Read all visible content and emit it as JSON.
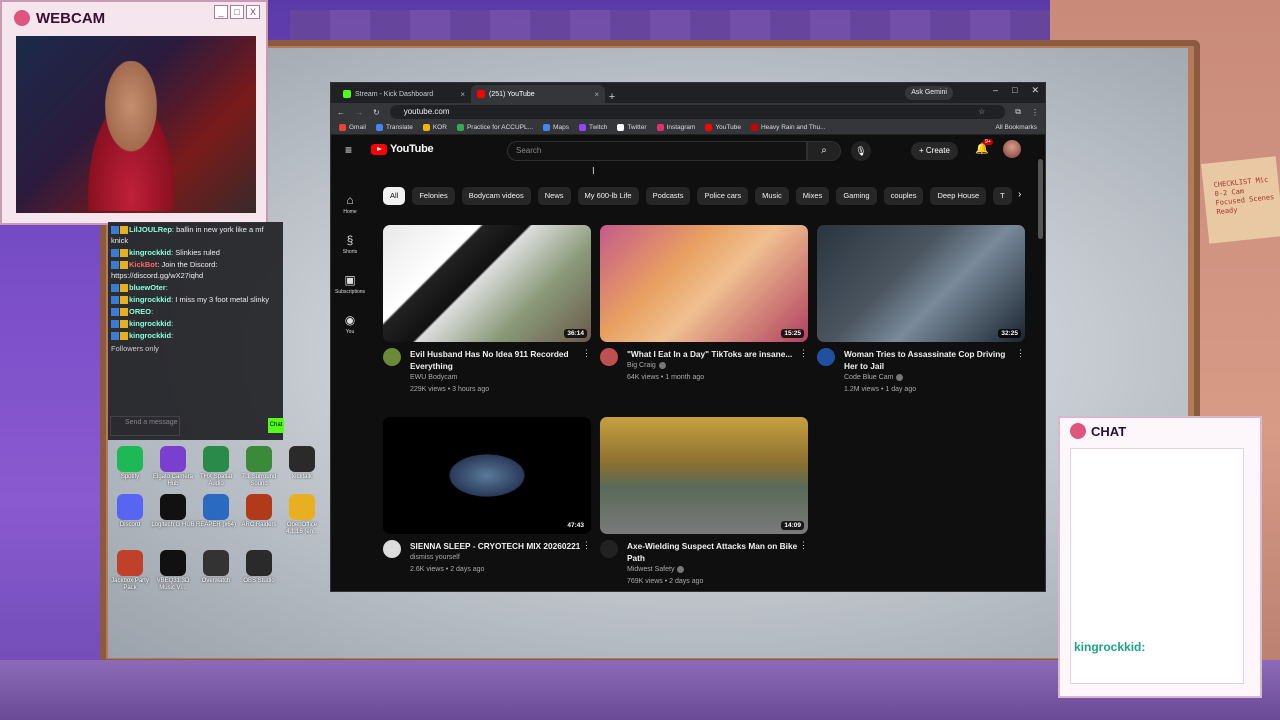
{
  "webcam": {
    "title": "WEBCAM",
    "controls": [
      "_",
      "□",
      "X"
    ]
  },
  "chatlog": {
    "lines": [
      {
        "user": "LilJOULRep",
        "text": "ballin in new york like a mf knick"
      },
      {
        "user": "kingrockkid",
        "text": "Slinkies ruled"
      },
      {
        "user": "KickBot",
        "text": "Join the Discord: https://discord.gg/wX27iqhd"
      },
      {
        "user": "bluewOter",
        "text": ""
      },
      {
        "user": "kingrockkid",
        "text": "I miss my 3 foot metal slinky"
      },
      {
        "user": "OREO",
        "text": ""
      },
      {
        "user": "kingrockkid",
        "text": ""
      },
      {
        "user": "kingrockkid",
        "text": ""
      }
    ],
    "followers_only": "Followers only",
    "input_placeholder": "Send a message",
    "send_label": "Chat"
  },
  "chatpanel": {
    "title": "CHAT",
    "message_user": "kingrockkid:"
  },
  "browser": {
    "tabs": [
      {
        "title": "Stream - Kick Dashboard",
        "color": "#53fc18"
      },
      {
        "title": "(251) YouTube",
        "color": "#ff0000"
      }
    ],
    "gemini": "Ask Gemini",
    "url": "youtube.com",
    "bookmarks": [
      "Gmail",
      "Translate",
      "KOR",
      "Practice for ACCUPL...",
      "Maps",
      "Twitch",
      "Twitter",
      "Instagram",
      "YouTube",
      "Heavy Rain and Thu..."
    ],
    "all_bookmarks": "All Bookmarks"
  },
  "youtube": {
    "logo": "YouTube",
    "search_placeholder": "Search",
    "create": "Create",
    "notif_count": "9+",
    "sidenav": [
      {
        "label": "Home",
        "icon": "home-icon",
        "glyph": "⌂"
      },
      {
        "label": "Shorts",
        "icon": "shorts-icon",
        "glyph": "§"
      },
      {
        "label": "Subscriptions",
        "icon": "subscriptions-icon",
        "glyph": "▣"
      },
      {
        "label": "You",
        "icon": "you-icon",
        "glyph": "◉"
      }
    ],
    "chips": [
      "All",
      "Felonies",
      "Bodycam videos",
      "News",
      "My 600-lb Life",
      "Podcasts",
      "Police cars",
      "Music",
      "Mixes",
      "Gaming",
      "couples",
      "Deep House",
      "T"
    ],
    "videos": [
      {
        "title": "Evil Husband Has No Idea 911 Recorded Everything",
        "channel": "EWU Bodycam",
        "stats": "229K views • 3 hours ago",
        "duration": "36:14",
        "verified": false
      },
      {
        "title": "\"What I Eat In a Day\" TikToks are insane...",
        "channel": "Big Craig",
        "stats": "64K views • 1 month ago",
        "duration": "15:25",
        "verified": true
      },
      {
        "title": "Woman Tries to Assassinate Cop Driving Her to Jail",
        "channel": "Code Blue Cam",
        "stats": "1.2M views • 1 day ago",
        "duration": "32:25",
        "verified": true
      },
      {
        "title": "SIENNA SLEEP - CRYOTECH MIX 20260221",
        "channel": "dismiss yourself",
        "stats": "2.6K views • 2 days ago",
        "duration": "47:43",
        "verified": false
      },
      {
        "title": "Axe-Wielding Suspect Attacks Man on Bike Path",
        "channel": "Midwest Safety",
        "stats": "769K views • 2 days ago",
        "duration": "14:09",
        "verified": true
      }
    ]
  },
  "desktop_icons": [
    "Spotify",
    "Elgato Camera Hub",
    "THX Spatial Audio",
    "7.1 Surround Sound",
    "kicktalk",
    "Discord",
    "Logitech G HUB",
    "REAPER (x64)",
    "ARC Raiders",
    "OpenOffice 4.1.16 (en...",
    "Jackbox Party Pack",
    "VBEQ31 3D Music Vi...",
    "Overwatch",
    "OBS Studio"
  ],
  "corkboard_note": "CHECKLIST Mic 0-2 Cam Focused Scenes Ready"
}
